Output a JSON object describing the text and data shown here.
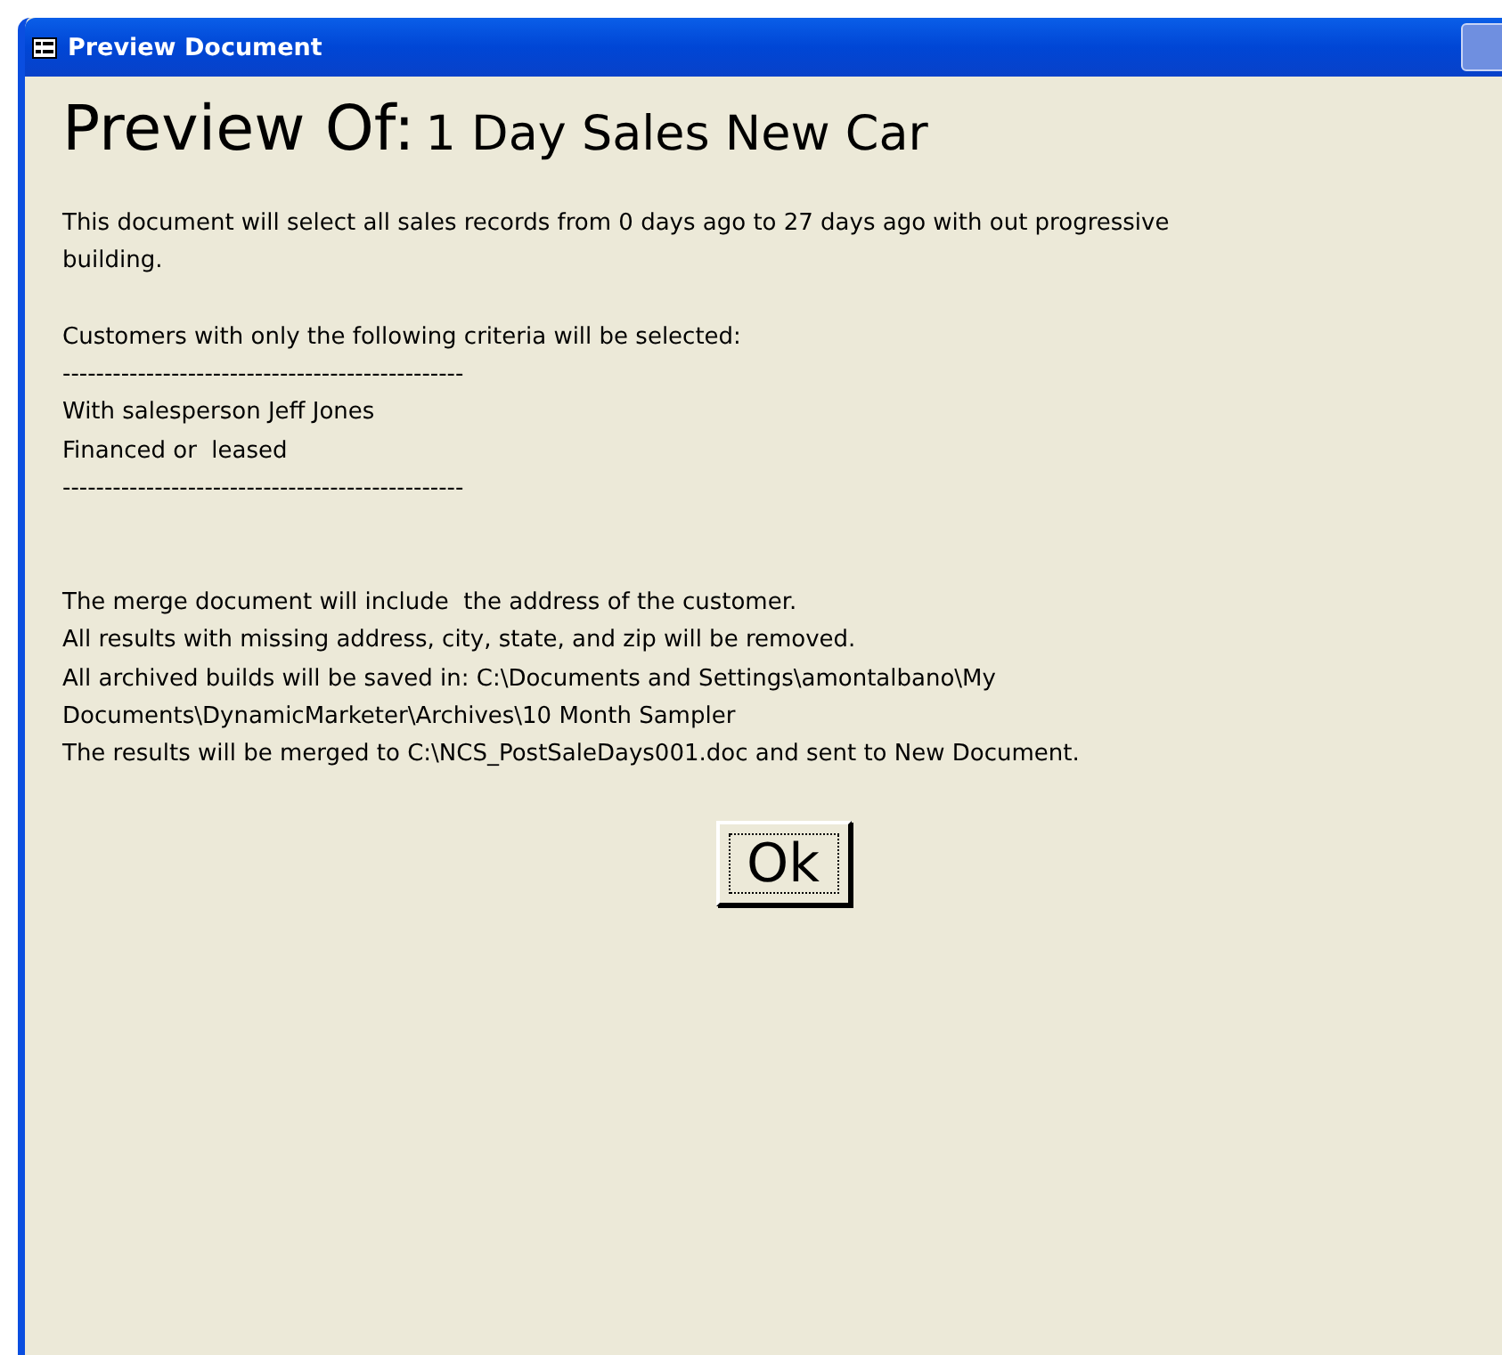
{
  "window": {
    "title": "Preview Document"
  },
  "heading": {
    "label": "Preview Of:",
    "name": "1 Day Sales New Car"
  },
  "lines": [
    {
      "kind": "text",
      "text": "This document will select all sales records from 0 days ago to 27 days ago with out progressive"
    },
    {
      "kind": "text",
      "text": "building."
    },
    {
      "kind": "blank"
    },
    {
      "kind": "text",
      "text": "Customers with only the following criteria will be selected:"
    },
    {
      "kind": "text",
      "text": "------------------------------------------------"
    },
    {
      "kind": "text",
      "text": "With salesperson Jeff Jones"
    },
    {
      "kind": "text",
      "text": "Financed or  leased"
    },
    {
      "kind": "text",
      "text": "------------------------------------------------"
    },
    {
      "kind": "blank"
    },
    {
      "kind": "blank"
    },
    {
      "kind": "text",
      "text": "The merge document will include  the address of the customer."
    },
    {
      "kind": "text",
      "text": "All results with missing address, city, state, and zip will be removed."
    },
    {
      "kind": "text",
      "text": "All archived builds will be saved in: C:\\Documents and Settings\\amontalbano\\My"
    },
    {
      "kind": "text",
      "text": "Documents\\DynamicMarketer\\Archives\\10 Month Sampler"
    },
    {
      "kind": "text",
      "text": "The results will be merged to C:\\NCS_PostSaleDays001.doc and sent to New Document."
    }
  ],
  "ok_button": {
    "label": "Ok"
  }
}
